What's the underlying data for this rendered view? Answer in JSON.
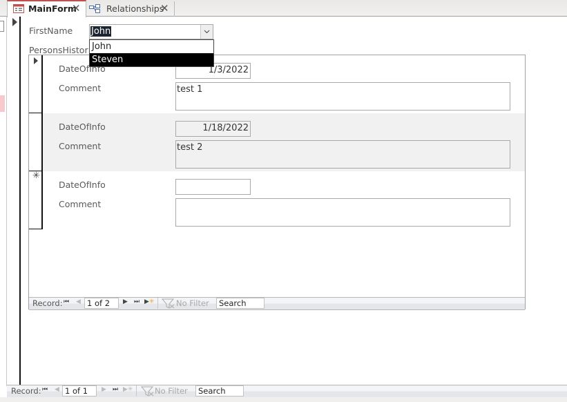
{
  "tabs": [
    {
      "label": "MainForm",
      "icon": "form-icon",
      "active": true
    },
    {
      "label": "Relationships",
      "icon": "relationships-icon",
      "active": false
    }
  ],
  "main_form": {
    "firstname_label": "FirstName",
    "firstname_value": "John",
    "dropdown_options": [
      {
        "label": "John",
        "highlighted": false
      },
      {
        "label": "Steven",
        "highlighted": true
      }
    ],
    "subform_label": "PersonsHistory",
    "subform_label_visible": "PersonsHistor"
  },
  "subform": {
    "rows": [
      {
        "date_label": "DateOfInfo",
        "date_value": "1/3/2022",
        "comment_label": "Comment",
        "comment_value": "test 1",
        "selector": "current"
      },
      {
        "date_label": "DateOfInfo",
        "date_value": "1/18/2022",
        "comment_label": "Comment",
        "comment_value": "test 2",
        "selector": "none"
      },
      {
        "date_label": "DateOfInfo",
        "date_value": "",
        "comment_label": "Comment",
        "comment_value": "",
        "selector": "new"
      }
    ],
    "nav": {
      "record_label": "Record:",
      "position": "1 of 2",
      "filter_label": "No Filter",
      "search_label": "Search"
    }
  },
  "main_nav": {
    "record_label": "Record:",
    "position": "1 of 1",
    "filter_label": "No Filter",
    "search_label": "Search"
  },
  "colors": {
    "active_tab_accent": "#c0504d",
    "selection_highlight": "#1b2430",
    "alt_row_background": "#f1f1f1",
    "new_record_icon": "#f0a030"
  }
}
